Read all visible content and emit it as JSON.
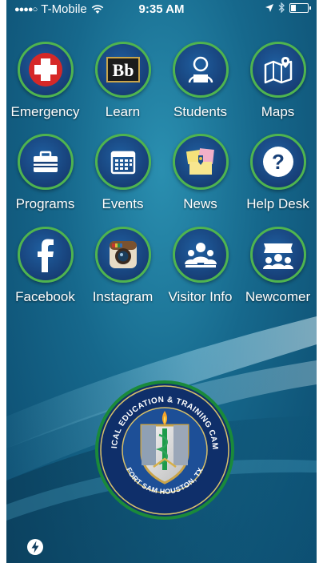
{
  "status_bar": {
    "carrier": "T-Mobile",
    "time": "9:35 AM",
    "signal_dots": "●●●●○"
  },
  "apps": [
    {
      "label": "Emergency",
      "icon": "red-cross-icon"
    },
    {
      "label": "Learn",
      "icon": "blackboard-bb-icon"
    },
    {
      "label": "Students",
      "icon": "student-icon"
    },
    {
      "label": "Maps",
      "icon": "map-icon"
    },
    {
      "label": "Programs",
      "icon": "briefcase-icon"
    },
    {
      "label": "Events",
      "icon": "calendar-icon"
    },
    {
      "label": "News",
      "icon": "news-board-icon"
    },
    {
      "label": "Help Desk",
      "icon": "question-icon"
    },
    {
      "label": "Facebook",
      "icon": "facebook-icon"
    },
    {
      "label": "Instagram",
      "icon": "instagram-icon"
    },
    {
      "label": "Visitor Info",
      "icon": "visitor-icon"
    },
    {
      "label": "Newcomer",
      "icon": "newcomer-icon"
    }
  ],
  "seal": {
    "top_text": "MEDICAL EDUCATION & TRAINING CAMPUS",
    "bottom_text": "FORT SAM HOUSTON, TX"
  },
  "colors": {
    "ring": "#4fb44f",
    "icon_bg": "#173f77",
    "background": "#16688c"
  }
}
